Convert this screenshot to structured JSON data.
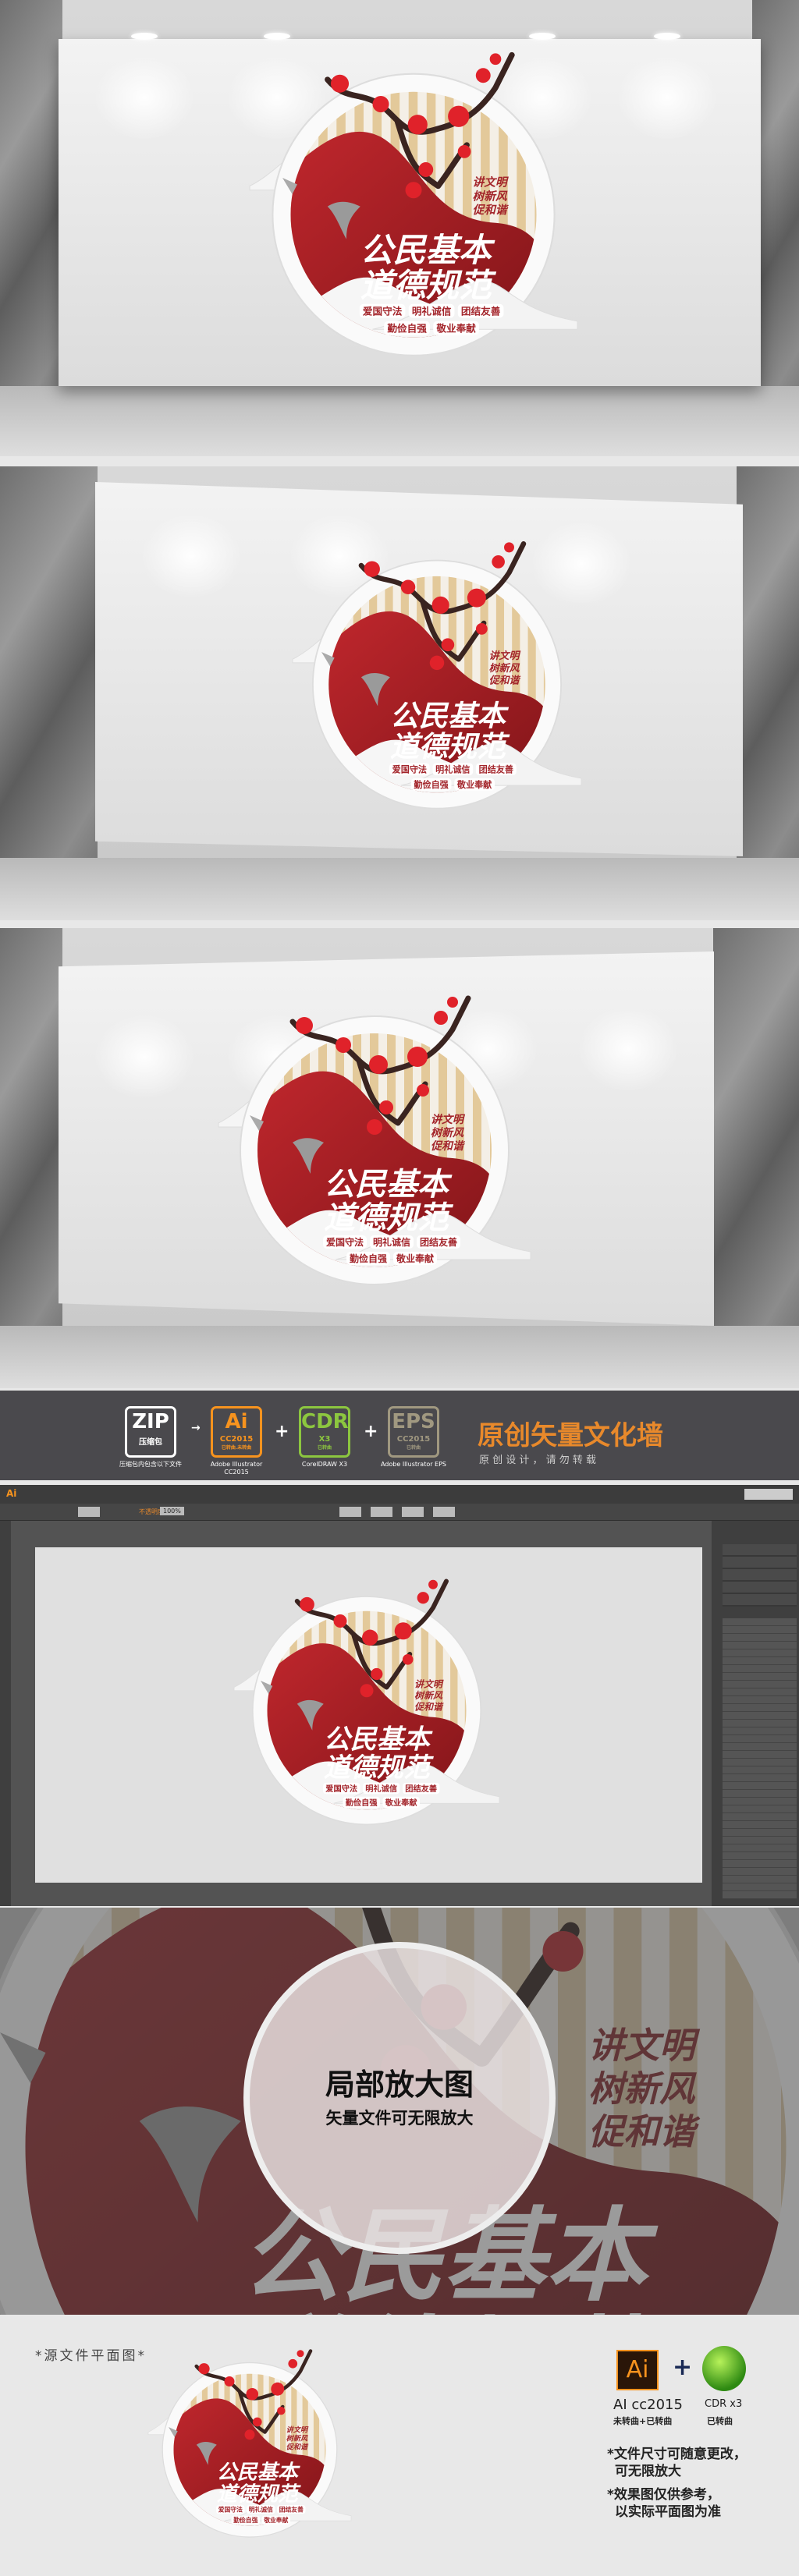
{
  "sign": {
    "slogan": [
      "讲文明",
      "树新风",
      "促和谐"
    ],
    "title_line1": "公民基本",
    "title_line2": "道德规范",
    "tags": [
      "爱国守法",
      "明礼诚信",
      "团结友善",
      "勤俭自强",
      "敬业奉献"
    ],
    "colors": {
      "red": "#9b1c22",
      "stripe": "#e3c99a",
      "flower": "#e0222a"
    }
  },
  "banner": {
    "zip": {
      "big": "ZIP",
      "sub": "压缩包",
      "caption": "压缩包内包含以下文件"
    },
    "arrow": "→",
    "ai": {
      "big": "Ai",
      "sub": "CC2015",
      "sub2": "已转曲.未转曲",
      "caption": "Adobe Illustrator CC2015",
      "color": "#f7931e"
    },
    "cdr": {
      "big": "CDR",
      "sub": "X3",
      "sub2": "已转曲",
      "caption": "CorelDRAW X3",
      "color": "#8cc63f"
    },
    "eps": {
      "big": "EPS",
      "sub": "CC2015",
      "sub2": "已转曲",
      "caption": "Adobe Illustrator EPS",
      "color": "#a09880"
    },
    "plus": "+",
    "headline": "原创矢量文化墙",
    "subline": "原 创 设 计 ， 请 勿 转 载",
    "headline_color": "#e8892b"
  },
  "illustrator": {
    "logo": "Ai",
    "opacity_label": "不透明度",
    "opacity_value": "100%"
  },
  "zoom": {
    "title": "局部放大图",
    "subtitle": "矢量文件可无限放大"
  },
  "bottom": {
    "label": "*源文件平面图*",
    "ai_icon": "Ai",
    "plus": "+",
    "ai_caption": "AI cc2015",
    "ai_caption2": "未转曲+已转曲",
    "cdr_caption": "CDR x3",
    "cdr_caption2": "已转曲",
    "note1a": "*文件尺寸可随意更改，",
    "note1b": "可无限放大",
    "note2a": "*效果图仅供参考，",
    "note2b": "以实际平面图为准"
  }
}
